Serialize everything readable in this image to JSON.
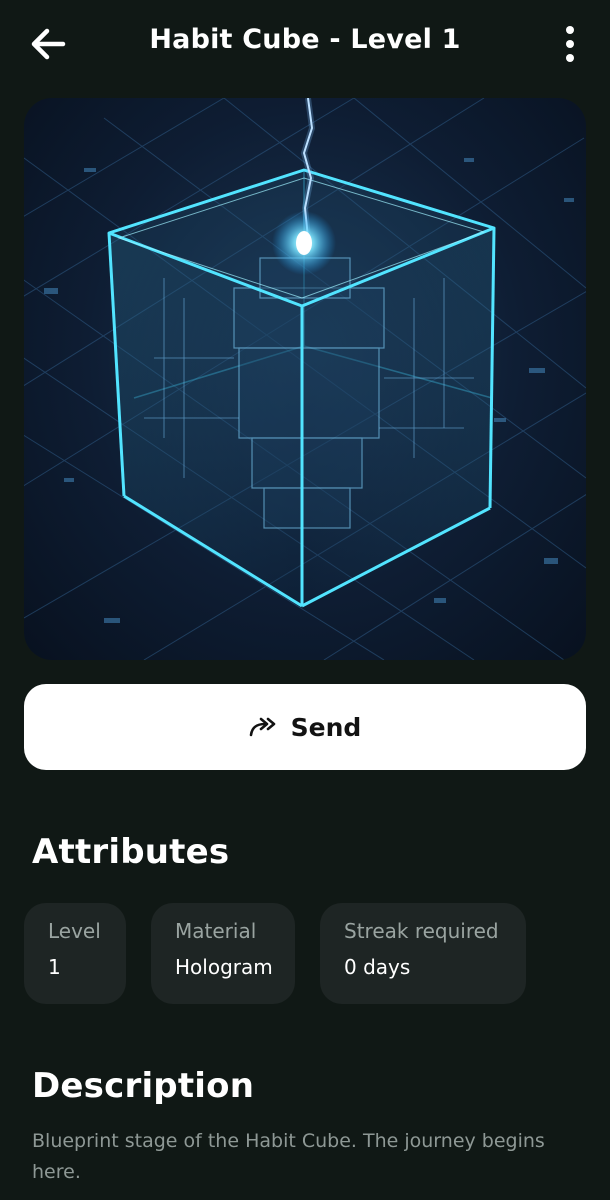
{
  "header": {
    "title": "Habit Cube - Level 1",
    "back_icon": "arrow-left-icon",
    "menu_icon": "more-vertical-icon"
  },
  "hero": {
    "image": "holographic-blueprint-cube"
  },
  "send_button": {
    "label": "Send",
    "icon": "send-forward-icon"
  },
  "attributes": {
    "title": "Attributes",
    "items": [
      {
        "label": "Level",
        "value": "1"
      },
      {
        "label": "Material",
        "value": "Hologram"
      },
      {
        "label": "Streak required",
        "value": "0 days"
      }
    ]
  },
  "description": {
    "title": "Description",
    "text": "Blueprint stage of the Habit Cube. The journey begins here."
  },
  "colors": {
    "background": "#101815",
    "card": "#1e2524",
    "muted_text": "#9aa4a1",
    "hologram_accent": "#41d9ff"
  }
}
